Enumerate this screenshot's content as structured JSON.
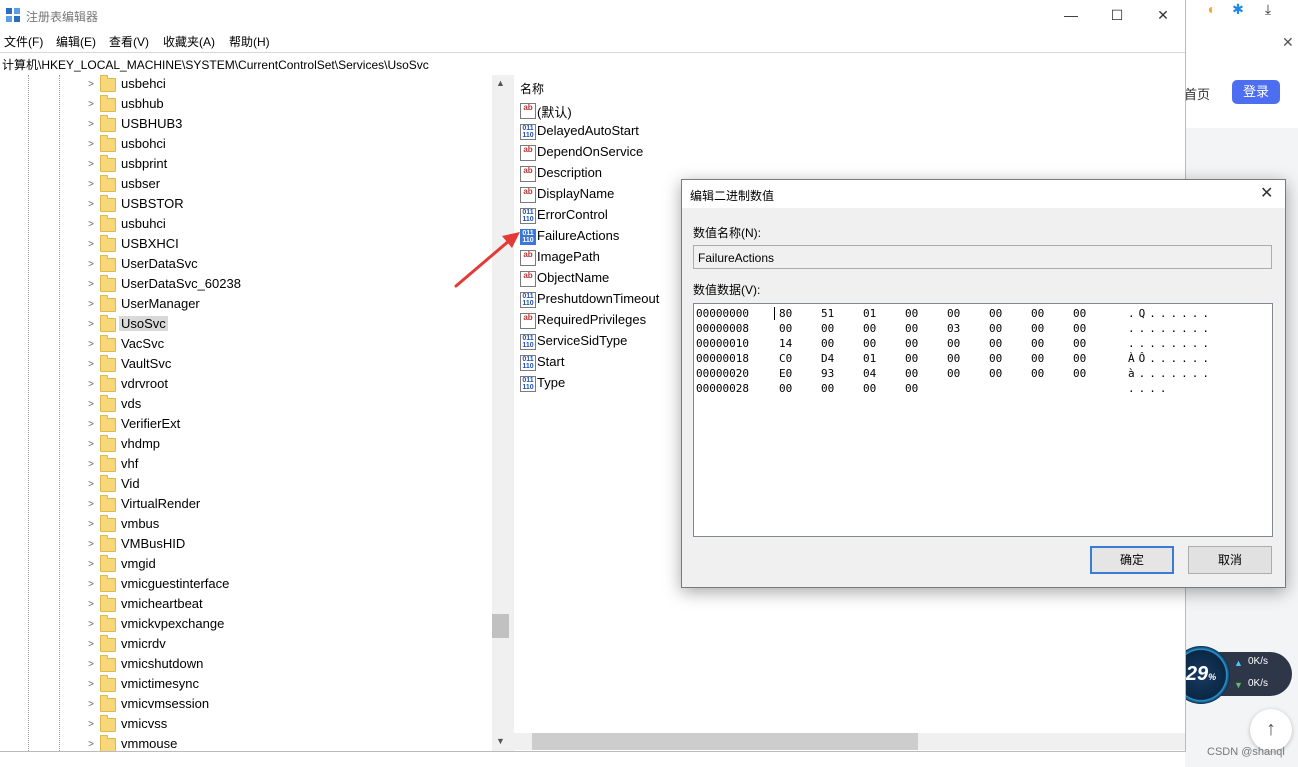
{
  "window": {
    "title": "注册表编辑器",
    "minimize": "—",
    "maximize": "☐",
    "close": "✕"
  },
  "menu": [
    "文件(F)",
    "编辑(E)",
    "查看(V)",
    "收藏夹(A)",
    "帮助(H)"
  ],
  "address": "计算机\\HKEY_LOCAL_MACHINE\\SYSTEM\\CurrentControlSet\\Services\\UsoSvc",
  "tree": {
    "selected": "UsoSvc",
    "items": [
      "usbehci",
      "usbhub",
      "USBHUB3",
      "usbohci",
      "usbprint",
      "usbser",
      "USBSTOR",
      "usbuhci",
      "USBXHCI",
      "UserDataSvc",
      "UserDataSvc_60238",
      "UserManager",
      "UsoSvc",
      "VacSvc",
      "VaultSvc",
      "vdrvroot",
      "vds",
      "VerifierExt",
      "vhdmp",
      "vhf",
      "Vid",
      "VirtualRender",
      "vmbus",
      "VMBusHID",
      "vmgid",
      "vmicguestinterface",
      "vmicheartbeat",
      "vmickvpexchange",
      "vmicrdv",
      "vmicshutdown",
      "vmictimesync",
      "vmicvmsession",
      "vmicvss",
      "vmmouse"
    ]
  },
  "values": {
    "column_header": "名称",
    "items": [
      {
        "name": "(默认)",
        "type": "string"
      },
      {
        "name": "DelayedAutoStart",
        "type": "binary"
      },
      {
        "name": "DependOnService",
        "type": "string"
      },
      {
        "name": "Description",
        "type": "string"
      },
      {
        "name": "DisplayName",
        "type": "string"
      },
      {
        "name": "ErrorControl",
        "type": "binary"
      },
      {
        "name": "FailureActions",
        "type": "binary",
        "selected": true
      },
      {
        "name": "ImagePath",
        "type": "string"
      },
      {
        "name": "ObjectName",
        "type": "string"
      },
      {
        "name": "PreshutdownTimeout",
        "type": "binary"
      },
      {
        "name": "RequiredPrivileges",
        "type": "string"
      },
      {
        "name": "ServiceSidType",
        "type": "binary"
      },
      {
        "name": "Start",
        "type": "binary"
      },
      {
        "name": "Type",
        "type": "binary"
      }
    ]
  },
  "icons": {
    "string": "ab",
    "binary": "011\n110"
  },
  "dialog": {
    "title": "编辑二进制数值",
    "close": "✕",
    "name_label": "数值名称(N):",
    "name_value": "FailureActions",
    "data_label": "数值数据(V):",
    "ok": "确定",
    "cancel": "取消",
    "hex_rows": [
      {
        "offset": "00000000",
        "bytes": [
          "80",
          "51",
          "01",
          "00",
          "00",
          "00",
          "00",
          "00"
        ],
        "ascii": ".Q......"
      },
      {
        "offset": "00000008",
        "bytes": [
          "00",
          "00",
          "00",
          "00",
          "03",
          "00",
          "00",
          "00"
        ],
        "ascii": "........"
      },
      {
        "offset": "00000010",
        "bytes": [
          "14",
          "00",
          "00",
          "00",
          "00",
          "00",
          "00",
          "00"
        ],
        "ascii": "........"
      },
      {
        "offset": "00000018",
        "bytes": [
          "C0",
          "D4",
          "01",
          "00",
          "00",
          "00",
          "00",
          "00"
        ],
        "ascii": "ÀÔ......"
      },
      {
        "offset": "00000020",
        "bytes": [
          "E0",
          "93",
          "04",
          "00",
          "00",
          "00",
          "00",
          "00"
        ],
        "ascii": "à......."
      },
      {
        "offset": "00000028",
        "bytes": [
          "00",
          "00",
          "00",
          "00"
        ],
        "ascii": "...."
      }
    ]
  },
  "background": {
    "home_text": "首页",
    "login_text": "登录",
    "speed_percent": "29",
    "speed_unit": "%",
    "upload": "0K/s",
    "download": "0K/s",
    "watermark": "CSDN @shanql",
    "scroll_top": "↑",
    "close_x": "✕"
  }
}
